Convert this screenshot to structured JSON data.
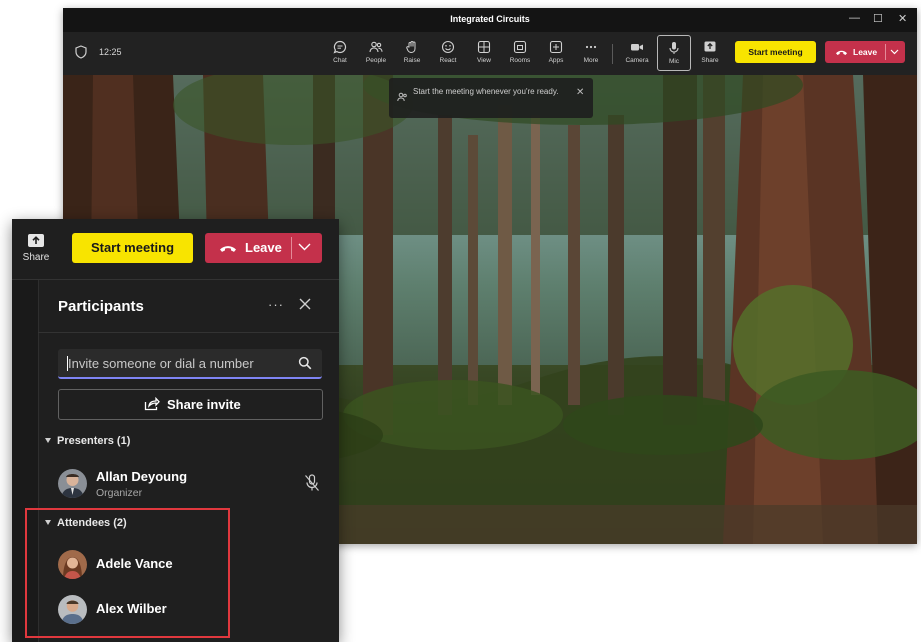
{
  "window": {
    "title": "Integrated Circuits",
    "controls": [
      "—",
      "☐",
      "✕"
    ]
  },
  "toolbar": {
    "time": "12:25",
    "buttons": [
      {
        "label": "Chat",
        "icon": "chat-icon"
      },
      {
        "label": "People",
        "icon": "people-icon"
      },
      {
        "label": "Raise",
        "icon": "raise-hand-icon"
      },
      {
        "label": "React",
        "icon": "react-icon"
      },
      {
        "label": "View",
        "icon": "view-icon"
      },
      {
        "label": "Rooms",
        "icon": "rooms-icon"
      },
      {
        "label": "Apps",
        "icon": "apps-icon"
      },
      {
        "label": "More",
        "icon": "more-icon"
      },
      {
        "label": "Camera",
        "icon": "camera-icon"
      },
      {
        "label": "Mic",
        "icon": "mic-icon"
      },
      {
        "label": "Share",
        "icon": "share-icon"
      }
    ],
    "start_label": "Start meeting",
    "leave_label": "Leave"
  },
  "toast": {
    "text": "Start the meeting whenever you're ready."
  },
  "panel": {
    "share_label": "Share",
    "start_label": "Start meeting",
    "leave_label": "Leave",
    "title": "Participants",
    "more": "···",
    "search_placeholder": "Invite someone or dial a number",
    "share_invite_label": "Share invite",
    "presenters_header": "Presenters (1)",
    "attendees_header": "Attendees (2)",
    "presenters": [
      {
        "name": "Allan Deyoung",
        "role": "Organizer"
      }
    ],
    "attendees": [
      {
        "name": "Adele Vance"
      },
      {
        "name": "Alex Wilber"
      }
    ]
  },
  "colors": {
    "accent_yellow": "#f8e400",
    "leave_red": "#c4314b",
    "focus_blue": "#7f85f5",
    "highlight_red": "#e0383e"
  }
}
